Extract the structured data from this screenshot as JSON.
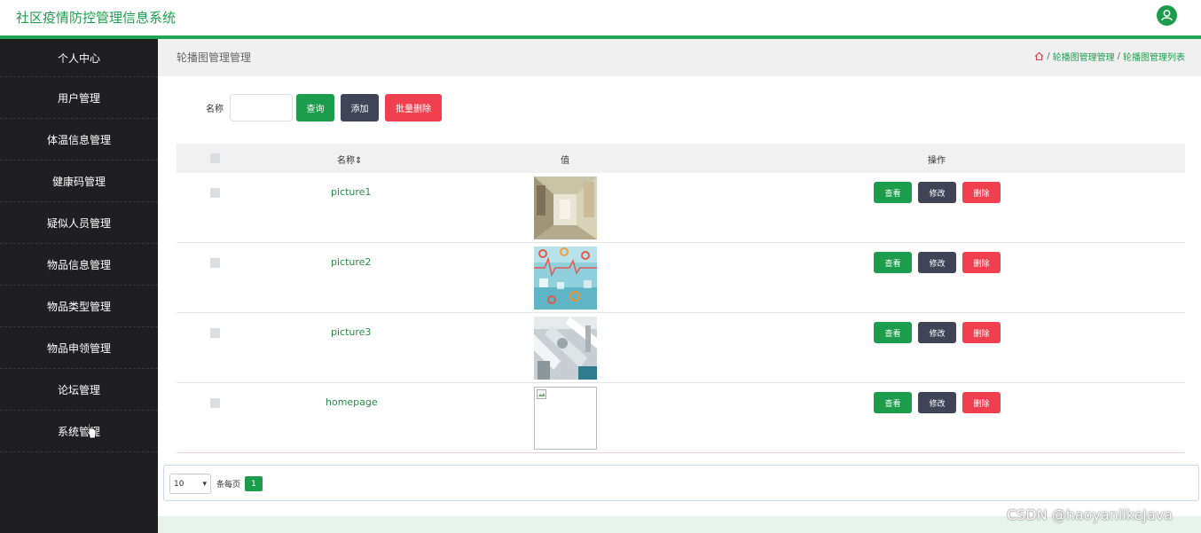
{
  "app": {
    "title": "社区疫情防控管理信息系统",
    "accent": "#1b9d4b"
  },
  "sidebar": {
    "items": [
      {
        "label": "个人中心"
      },
      {
        "label": "用户管理"
      },
      {
        "label": "体温信息管理"
      },
      {
        "label": "健康码管理"
      },
      {
        "label": "疑似人员管理"
      },
      {
        "label": "物品信息管理"
      },
      {
        "label": "物品类型管理"
      },
      {
        "label": "物品申领管理"
      },
      {
        "label": "论坛管理"
      },
      {
        "label": "系统管理"
      }
    ]
  },
  "header": {
    "page_title": "轮播图管理管理",
    "breadcrumb": [
      "/",
      "轮播图管理管理",
      "/",
      "轮播图管理列表"
    ]
  },
  "search": {
    "name_label": "名称",
    "query_label": "查询",
    "add_label": "添加",
    "batch_delete_label": "批量删除"
  },
  "table": {
    "columns": {
      "name": "名称",
      "value": "值",
      "actions": "操作"
    },
    "rows": [
      {
        "name": "picture1",
        "image": "corridor"
      },
      {
        "name": "picture2",
        "image": "medical-pattern"
      },
      {
        "name": "picture3",
        "image": "equipment"
      },
      {
        "name": "homepage",
        "image": "broken"
      }
    ],
    "view_label": "查看",
    "edit_label": "修改",
    "delete_label": "删除"
  },
  "pagination": {
    "page_size": "10",
    "per_page_label": "条每页",
    "current_page": "1"
  },
  "watermark": "CSDN @haoyanlikeJava"
}
